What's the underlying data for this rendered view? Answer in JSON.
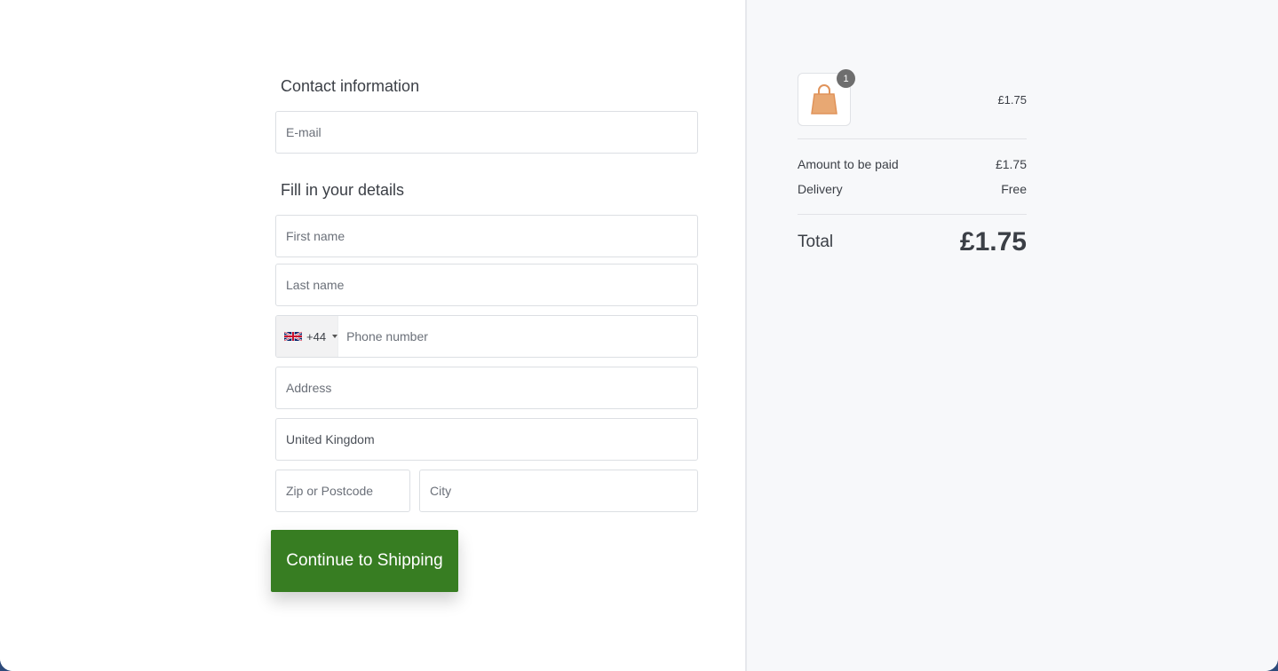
{
  "form": {
    "contact_title": "Contact information",
    "email_placeholder": "E-mail",
    "details_title": "Fill in your details",
    "first_name_placeholder": "First name",
    "last_name_placeholder": "Last name",
    "phone": {
      "country_flag": "uk-flag-icon",
      "dial_code": "+44",
      "placeholder": "Phone number"
    },
    "address_placeholder": "Address",
    "country_value": "United Kingdom",
    "zip_placeholder": "Zip or Postcode",
    "city_placeholder": "City",
    "submit_label": "Continue to Shipping"
  },
  "summary": {
    "item": {
      "icon": "shopping-bag-icon",
      "quantity": "1",
      "price": "£1.75"
    },
    "amount_label": "Amount to be paid",
    "amount_value": "£1.75",
    "delivery_label": "Delivery",
    "delivery_value": "Free",
    "total_label": "Total",
    "total_value": "£1.75"
  },
  "colors": {
    "primary_button": "#377d22",
    "bag_icon": "#e8a873",
    "summary_bg": "#f7f8fa"
  }
}
